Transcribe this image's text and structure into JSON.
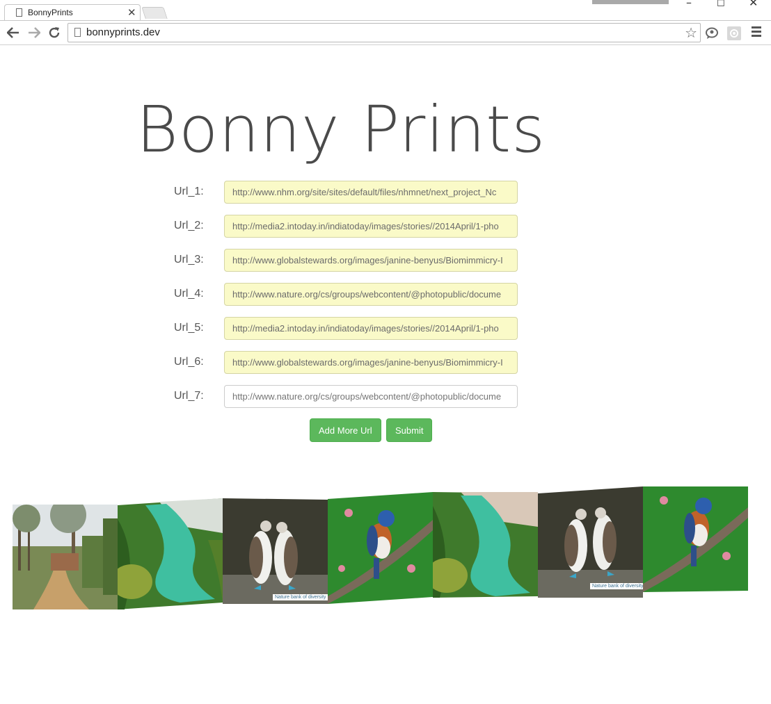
{
  "browser": {
    "tab_title": "BonnyPrints",
    "tab_close": "✕",
    "address": "bonnyprints.dev",
    "window_controls": {
      "minimize": "–",
      "maximize": "☐",
      "close": "✕"
    },
    "icons": [
      "back-arrow-icon",
      "forward-arrow-icon",
      "reload-icon",
      "page-icon",
      "star-icon",
      "extension-icon",
      "settings-extension-icon",
      "menu-icon"
    ]
  },
  "page": {
    "title": "Bonny Prints",
    "url_fields": [
      {
        "label": "Url_1:",
        "value": "http://www.nhm.org/site/sites/default/files/nhmnet/next_project_Nc"
      },
      {
        "label": "Url_2:",
        "value": "http://media2.intoday.in/indiatoday/images/stories//2014April/1-pho"
      },
      {
        "label": "Url_3:",
        "value": "http://www.globalstewards.org/images/janine-benyus/Biomimmicry-I"
      },
      {
        "label": "Url_4:",
        "value": "http://www.nature.org/cs/groups/webcontent/@photopublic/docume"
      },
      {
        "label": "Url_5:",
        "value": "http://media2.intoday.in/indiatoday/images/stories//2014April/1-pho"
      },
      {
        "label": "Url_6:",
        "value": "http://www.globalstewards.org/images/janine-benyus/Biomimmicry-I"
      },
      {
        "label": "Url_7:",
        "placeholder": "http://www.nature.org/cs/groups/webcontent/@photopublic/docume"
      }
    ],
    "add_more_label": "Add More Url",
    "submit_label": "Submit"
  },
  "gallery": {
    "photos": [
      {
        "subject": "park-path"
      },
      {
        "subject": "river-gorge"
      },
      {
        "subject": "blue-footed-boobies",
        "caption": "Nature bank of diversity"
      },
      {
        "subject": "bluebird"
      },
      {
        "subject": "river-gorge"
      },
      {
        "subject": "blue-footed-boobies",
        "caption": "Nature bank of diversity"
      },
      {
        "subject": "bluebird"
      }
    ]
  },
  "colors": {
    "button_green": "#5cb85c",
    "autofill_yellow": "#fafac8",
    "title_gray": "#4a4a4a"
  }
}
